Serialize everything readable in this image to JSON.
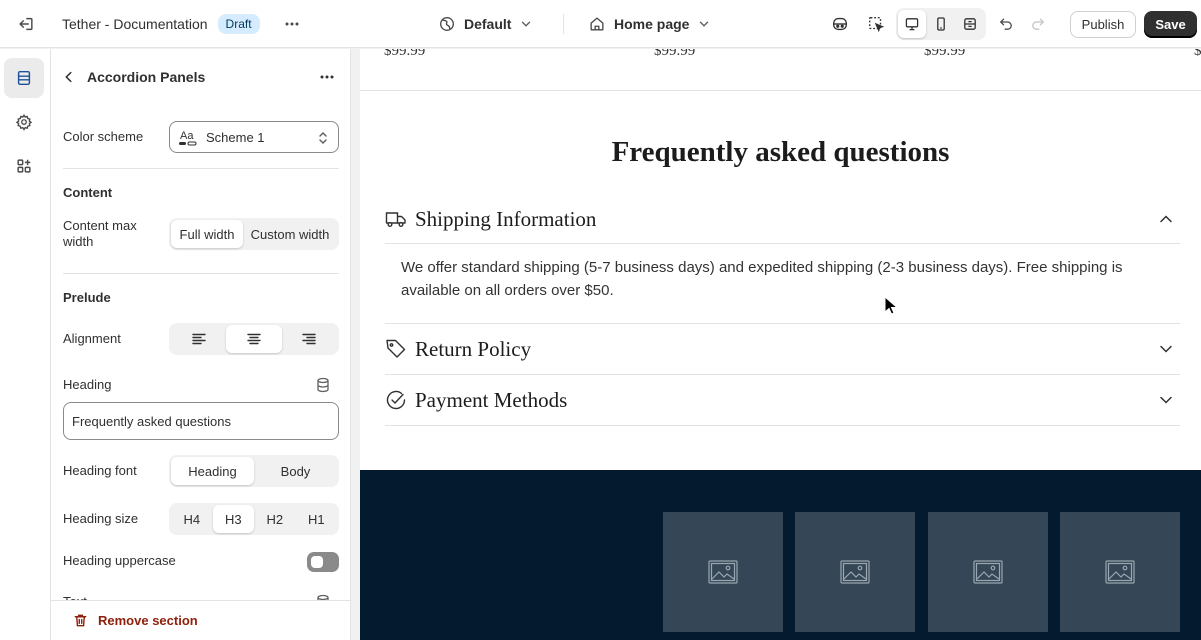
{
  "topbar": {
    "store_title": "Tether - Documentation",
    "status_badge": "Draft",
    "theme_selector": "Default",
    "page_selector": "Home page",
    "publish_label": "Publish",
    "save_label": "Save"
  },
  "rail": {
    "items": [
      {
        "icon": "sections-icon",
        "active": true
      },
      {
        "icon": "gear-icon",
        "active": false
      },
      {
        "icon": "apps-icon",
        "active": false
      }
    ]
  },
  "panel": {
    "title": "Accordion Panels",
    "color_scheme": {
      "label": "Color scheme",
      "value": "Scheme 1",
      "swatch_text": "Aa"
    },
    "content": {
      "section_title": "Content",
      "max_width_label": "Content max width",
      "max_width_options": [
        "Full width",
        "Custom width"
      ],
      "max_width_selected": "Full width"
    },
    "prelude": {
      "section_title": "Prelude",
      "alignment_label": "Alignment",
      "alignment_selected": "center",
      "heading_label": "Heading",
      "heading_value": "Frequently asked questions",
      "heading_font_label": "Heading font",
      "heading_font_options": [
        "Heading",
        "Body"
      ],
      "heading_font_selected": "Heading",
      "heading_size_label": "Heading size",
      "heading_size_options": [
        "H4",
        "H3",
        "H2",
        "H1"
      ],
      "heading_size_selected": "H3",
      "heading_uppercase_label": "Heading uppercase",
      "heading_uppercase_on": false,
      "text_label": "Text"
    },
    "remove_label": "Remove section"
  },
  "preview": {
    "prices": [
      "$99.99",
      "$99.99",
      "$99.99",
      "$"
    ],
    "faq_heading": "Frequently asked questions",
    "accordion": [
      {
        "icon": "truck-icon",
        "title": "Shipping Information",
        "expanded": true,
        "body": "We offer standard shipping (5-7 business days) and expedited shipping (2-3 business days). Free shipping is available on all orders over $50."
      },
      {
        "icon": "tag-icon",
        "title": "Return Policy",
        "expanded": false
      },
      {
        "icon": "check-circle-icon",
        "title": "Payment Methods",
        "expanded": false
      }
    ],
    "thumbnails": 4
  },
  "colors": {
    "accent_dark": "#303030",
    "badge_bg": "#d5ebff",
    "footer_band": "#041a2e",
    "thumb_placeholder": "#354656",
    "danger": "#8e1f0b"
  }
}
